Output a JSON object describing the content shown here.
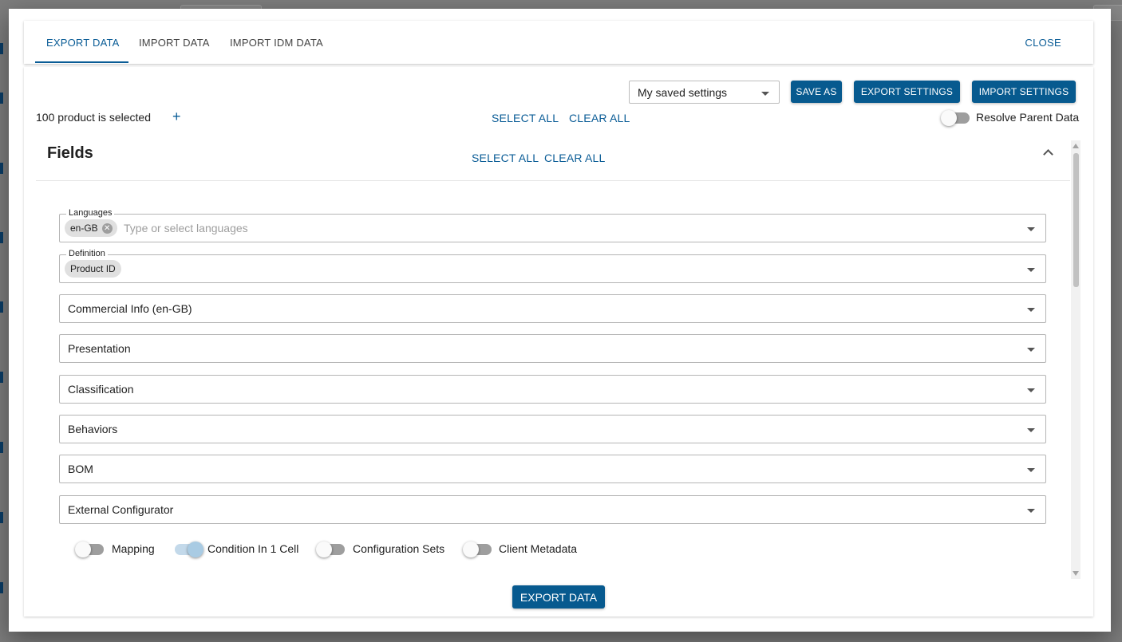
{
  "tabs": [
    {
      "label": "EXPORT DATA",
      "active": true
    },
    {
      "label": "IMPORT DATA",
      "active": false
    },
    {
      "label": "IMPORT IDM DATA",
      "active": false
    }
  ],
  "close_label": "CLOSE",
  "toolbar": {
    "saved_settings_value": "My saved settings",
    "save_as_label": "SAVE AS",
    "export_settings_label": "EXPORT SETTINGS",
    "import_settings_label": "IMPORT SETTINGS"
  },
  "selection": {
    "count_text": "100 product is selected",
    "add_icon": "+",
    "select_all_label": "SELECT ALL",
    "clear_all_label": "CLEAR ALL",
    "resolve_parent_label": "Resolve Parent Data",
    "resolve_parent_on": false
  },
  "fields": {
    "title": "Fields",
    "select_all_label": "SELECT ALL",
    "clear_all_label": "CLEAR ALL",
    "languages": {
      "legend": "Languages",
      "chip": "en-GB",
      "placeholder": "Type or select languages"
    },
    "definition": {
      "legend": "Definition",
      "chip": "Product ID"
    },
    "sections": [
      "Commercial Info (en-GB)",
      "Presentation",
      "Classification",
      "Behaviors",
      "BOM",
      "External Configurator"
    ],
    "toggles": [
      {
        "label": "Mapping",
        "on": false
      },
      {
        "label": "Condition In 1 Cell",
        "on": true
      },
      {
        "label": "Configuration Sets",
        "on": false
      },
      {
        "label": "Client Metadata",
        "on": false
      }
    ]
  },
  "export_button_label": "EXPORT DATA",
  "colors": {
    "accent": "#0a5c96",
    "button": "#075a8f"
  }
}
